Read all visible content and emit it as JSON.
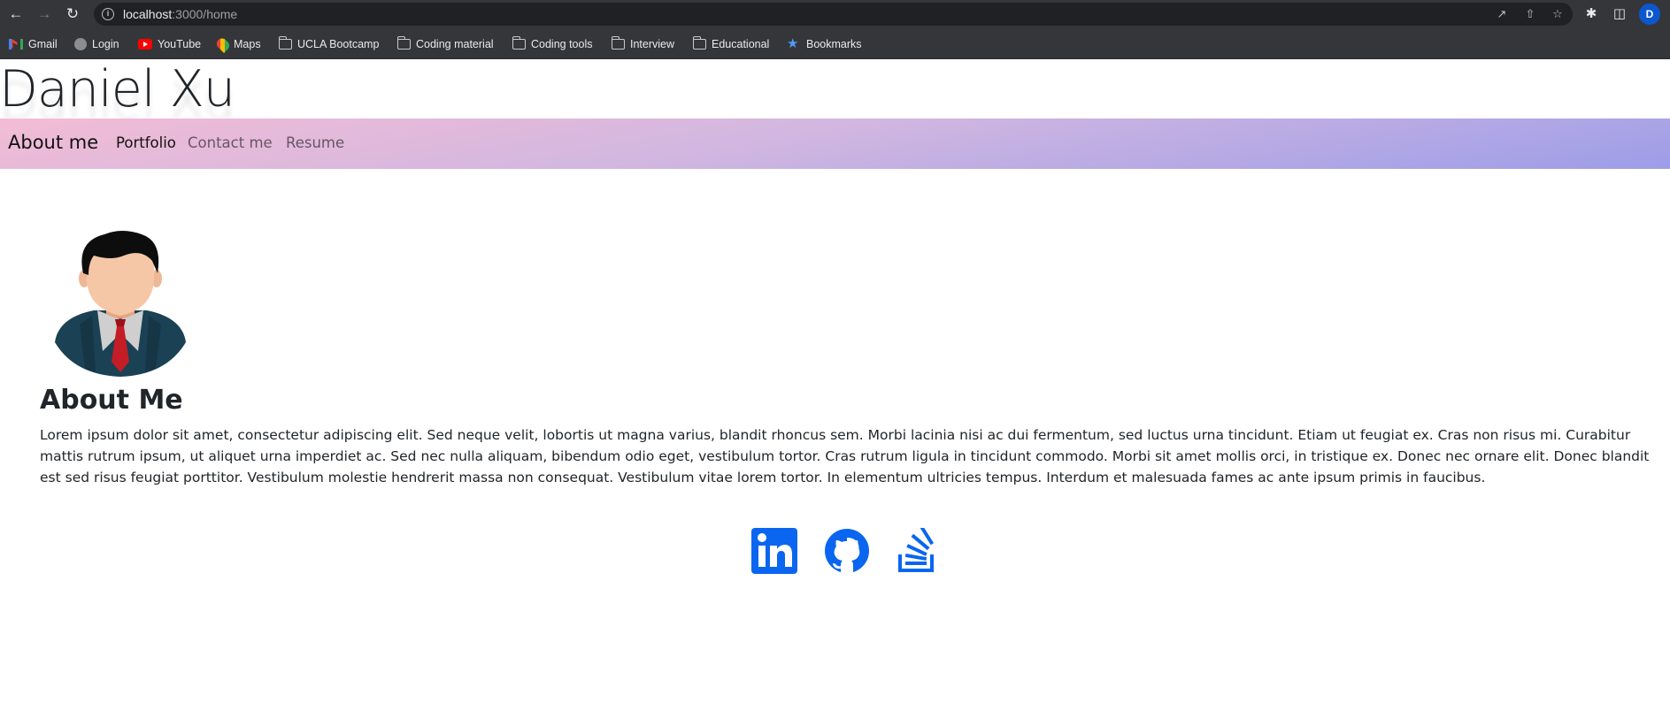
{
  "browser": {
    "url_host": "localhost",
    "url_path": ":3000/home",
    "profile_initial": "D",
    "bookmarks": [
      {
        "label": "Gmail",
        "icon": "gmail-icon"
      },
      {
        "label": "Login",
        "icon": "globe-icon"
      },
      {
        "label": "YouTube",
        "icon": "youtube-icon"
      },
      {
        "label": "Maps",
        "icon": "maps-icon"
      },
      {
        "label": "UCLA Bootcamp",
        "icon": "folder-icon"
      },
      {
        "label": "Coding material",
        "icon": "folder-icon"
      },
      {
        "label": "Coding tools",
        "icon": "folder-icon"
      },
      {
        "label": "Interview",
        "icon": "folder-icon"
      },
      {
        "label": "Educational",
        "icon": "folder-icon"
      },
      {
        "label": "Bookmarks",
        "icon": "star-icon"
      }
    ]
  },
  "site": {
    "title": "Daniel Xu",
    "nav": {
      "brand": "About me",
      "links": [
        "Portfolio",
        "Contact me",
        "Resume"
      ]
    },
    "about": {
      "heading": "About Me",
      "text": "Lorem ipsum dolor sit amet, consectetur adipiscing elit. Sed neque velit, lobortis ut magna varius, blandit rhoncus sem. Morbi lacinia nisi ac dui fermentum, sed luctus urna tincidunt. Etiam ut feugiat ex. Cras non risus mi. Curabitur mattis rutrum ipsum, ut aliquet urna imperdiet ac. Sed nec nulla aliquam, bibendum odio eget, vestibulum tortor. Cras rutrum ligula in tincidunt commodo. Morbi sit amet mollis orci, in tristique ex. Donec nec ornare elit. Donec blandit est sed risus feugiat porttitor. Vestibulum molestie hendrerit massa non consequat. Vestibulum vitae lorem tortor. In elementum ultricies tempus. Interdum et malesuada fames ac ante ipsum primis in faucibus."
    },
    "social": [
      {
        "icon": "linkedin-icon"
      },
      {
        "icon": "github-icon"
      },
      {
        "icon": "stackoverflow-icon"
      }
    ]
  },
  "colors": {
    "accent": "#0a66f0",
    "navbar_start": "#f3bcd5",
    "navbar_end": "#9d9de8",
    "chrome": "#35363a"
  }
}
